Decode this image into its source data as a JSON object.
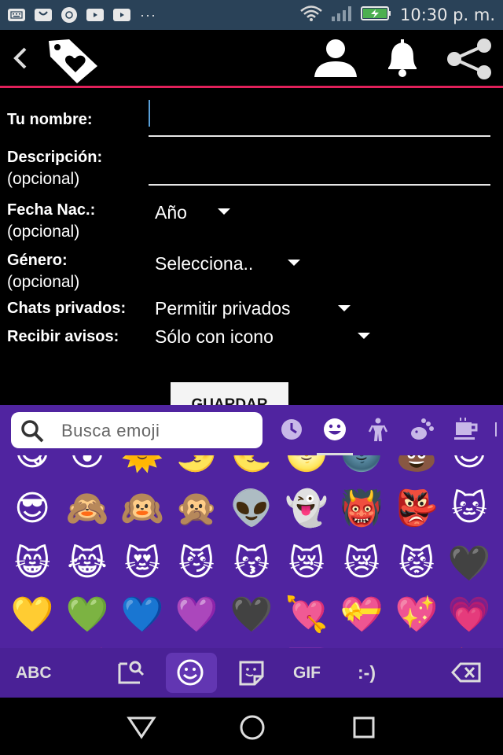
{
  "status_bar": {
    "time": "10:30 p. m.",
    "icons": [
      "keyboard-icon",
      "messenger-icon",
      "whatsapp-icon",
      "youtube-icon",
      "youtube-icon",
      "more-icon",
      "wifi-icon",
      "signal-icon",
      "battery-charging-icon"
    ],
    "overflow": "···"
  },
  "app_bar": {
    "icons": [
      "back-icon",
      "tag-heart-logo-icon",
      "profile-icon",
      "bell-icon",
      "share-icon"
    ],
    "accent_line_color": "#e0205a"
  },
  "form": {
    "name": {
      "label": "Tu nombre:",
      "value": ""
    },
    "description": {
      "label": "Descripción:",
      "sublabel": "(opcional)",
      "value": ""
    },
    "birth": {
      "label": "Fecha Nac.:",
      "sublabel": "(opcional)",
      "value": "Año"
    },
    "gender": {
      "label": "Género:",
      "sublabel": "(opcional)",
      "value": "Selecciona.."
    },
    "private_chats": {
      "label": "Chats privados:",
      "value": "Permitir privados"
    },
    "notifications": {
      "label": "Recibir avisos:",
      "value": "Sólo con icono"
    },
    "save_label": "GUARDAR"
  },
  "keyboard": {
    "search_placeholder": "Busca emoji",
    "categories": [
      "recent-icon",
      "smileys-icon",
      "people-icon",
      "animals-icon",
      "food-icon"
    ],
    "active_category": "smileys-icon",
    "background_color": "#5024a0",
    "emoji_rows": [
      [
        "😋",
        "😮",
        "🌞",
        "🌛",
        "🌜",
        "🌝",
        "🌚",
        "💩",
        "😊"
      ],
      [
        "😎",
        "🙈",
        "🙉",
        "🙊",
        "👽",
        "👻",
        "👹",
        "👺",
        "🐱"
      ],
      [
        "😸",
        "😹",
        "😻",
        "😼",
        "😽",
        "😿",
        "😿",
        "😾",
        "🖤"
      ],
      [
        "💛",
        "💚",
        "💙",
        "💜",
        "🖤",
        "💘",
        "💝",
        "💖",
        "💗"
      ],
      [
        "💓",
        "💕",
        "💞",
        "💌",
        "🖤",
        "💟",
        "💋",
        "💔",
        "💯"
      ]
    ],
    "bottom": {
      "abc_label": "ABC",
      "gif_label": "GIF",
      "emoticon_label": ":-)",
      "icons": [
        "search-sticker-icon",
        "emoji-icon",
        "sticker-icon",
        "backspace-icon"
      ],
      "active": "emoji-icon"
    }
  },
  "nav_bar": {
    "icons": [
      "back-triangle-icon",
      "home-circle-icon",
      "recents-square-icon"
    ]
  }
}
